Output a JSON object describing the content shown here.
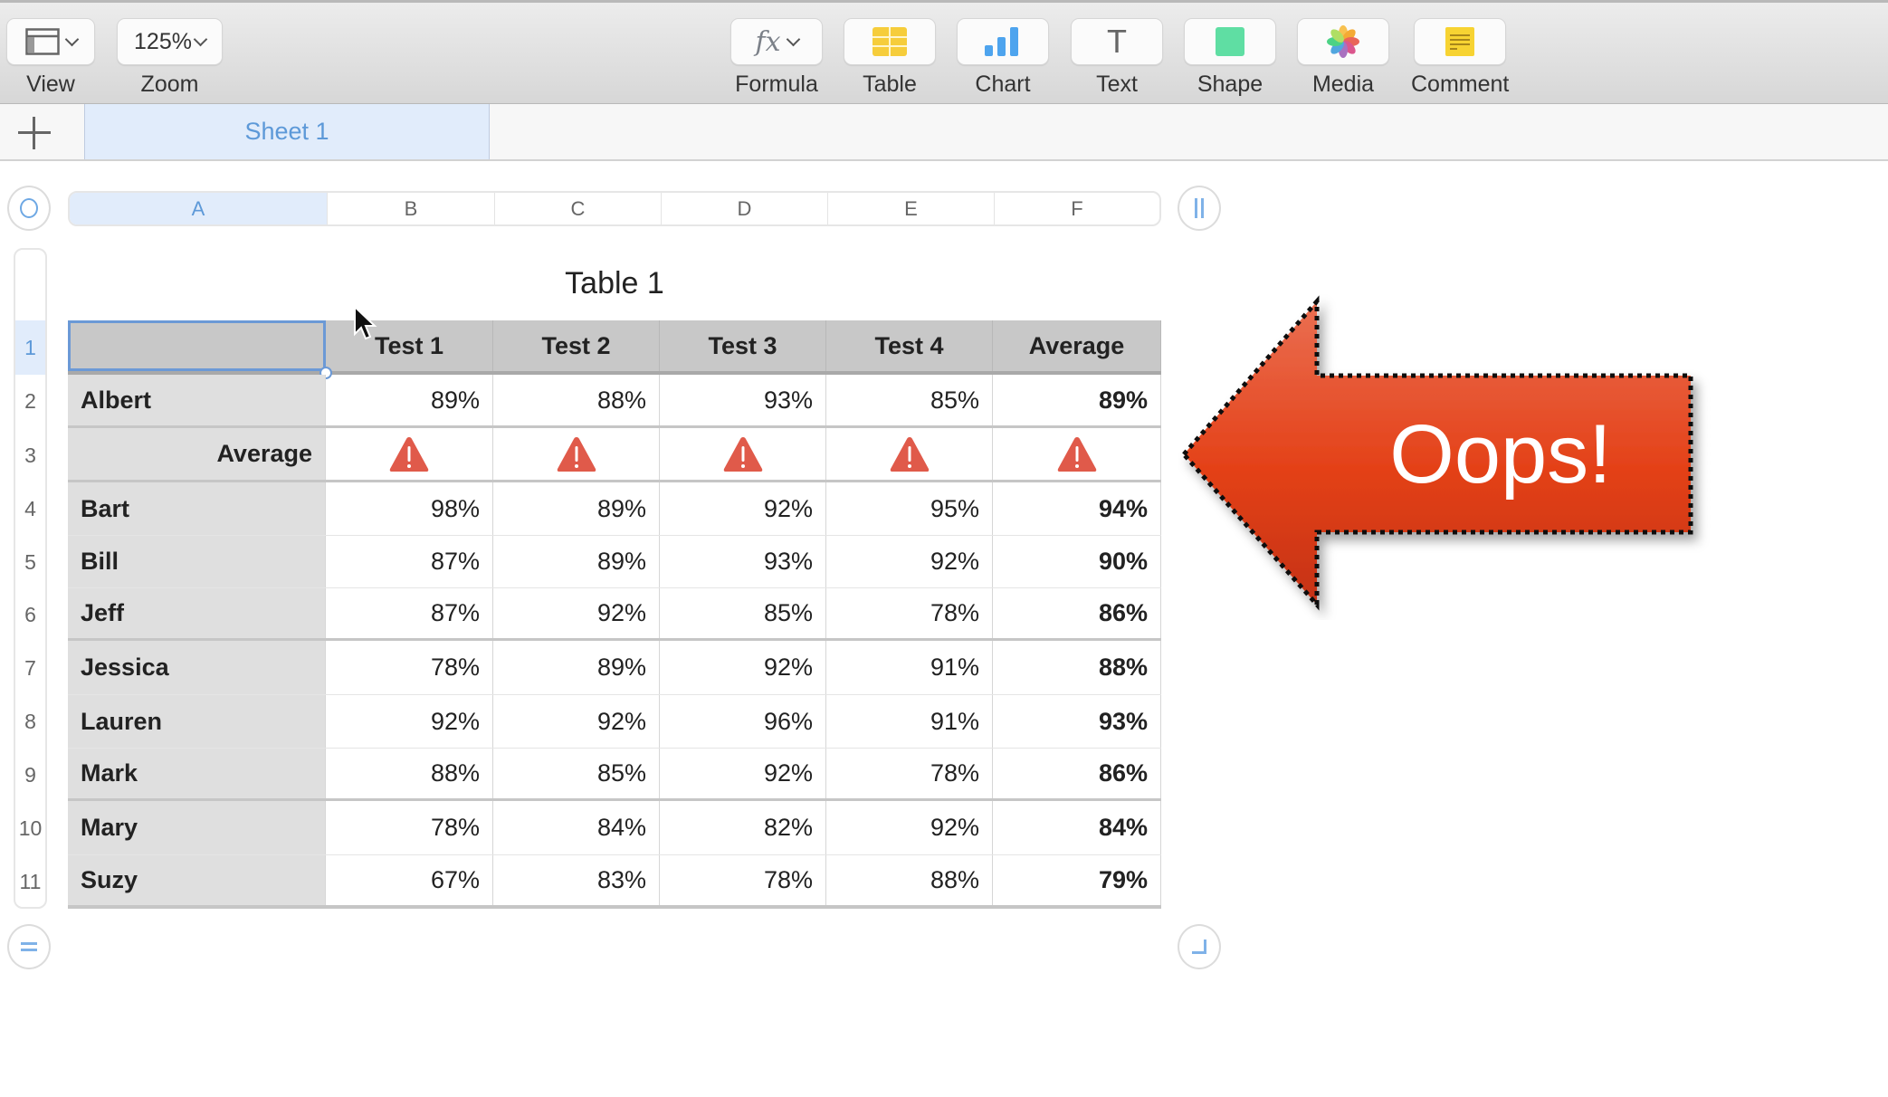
{
  "toolbar": {
    "left": [
      {
        "id": "view",
        "icon": "sidebar-layout-icon",
        "label": "View"
      },
      {
        "id": "zoom",
        "value": "125%",
        "label": "Zoom"
      }
    ],
    "right": [
      {
        "id": "formula",
        "icon": "fx-icon",
        "icon_text": "fx",
        "label": "Formula"
      },
      {
        "id": "table",
        "icon": "table-icon",
        "label": "Table"
      },
      {
        "id": "chart",
        "icon": "bar-chart-icon",
        "label": "Chart"
      },
      {
        "id": "text",
        "icon": "text-icon",
        "icon_text": "T",
        "label": "Text"
      },
      {
        "id": "shape",
        "icon": "shape-icon",
        "label": "Shape"
      },
      {
        "id": "media",
        "icon": "photos-icon",
        "label": "Media"
      },
      {
        "id": "comment",
        "icon": "comment-icon",
        "label": "Comment"
      }
    ]
  },
  "tabs": {
    "add_icon": "plus-icon",
    "sheets": [
      {
        "label": "Sheet 1",
        "active": true
      }
    ]
  },
  "spreadsheet": {
    "columns": [
      "A",
      "B",
      "C",
      "D",
      "E",
      "F"
    ],
    "selected_column": "A",
    "selected_row": "1",
    "row_numbers": [
      "1",
      "2",
      "3",
      "4",
      "5",
      "6",
      "7",
      "8",
      "9",
      "10",
      "11"
    ],
    "table_title": "Table 1",
    "header": [
      "",
      "Test 1",
      "Test 2",
      "Test 3",
      "Test 4",
      "Average"
    ],
    "rows": [
      {
        "name": "Albert",
        "values": [
          "89%",
          "88%",
          "93%",
          "85%"
        ],
        "average": "89%"
      },
      {
        "name": "Average",
        "type": "error",
        "values": [
          "warning",
          "warning",
          "warning",
          "warning"
        ],
        "average": "warning"
      },
      {
        "name": "Bart",
        "values": [
          "98%",
          "89%",
          "92%",
          "95%"
        ],
        "average": "94%"
      },
      {
        "name": "Bill",
        "values": [
          "87%",
          "89%",
          "93%",
          "92%"
        ],
        "average": "90%"
      },
      {
        "name": "Jeff",
        "values": [
          "87%",
          "92%",
          "85%",
          "78%"
        ],
        "average": "86%"
      },
      {
        "name": "Jessica",
        "values": [
          "78%",
          "89%",
          "92%",
          "91%"
        ],
        "average": "88%"
      },
      {
        "name": "Lauren",
        "values": [
          "92%",
          "92%",
          "96%",
          "91%"
        ],
        "average": "93%"
      },
      {
        "name": "Mark",
        "values": [
          "88%",
          "85%",
          "92%",
          "78%"
        ],
        "average": "86%"
      },
      {
        "name": "Mary",
        "values": [
          "78%",
          "84%",
          "82%",
          "92%"
        ],
        "average": "84%"
      },
      {
        "name": "Suzy",
        "values": [
          "67%",
          "83%",
          "78%",
          "88%"
        ],
        "average": "79%"
      }
    ],
    "controls": {
      "select_all_icon": "circle-select-icon",
      "column_handle_icon": "pause-bars-icon",
      "row_handle_icon": "equals-icon",
      "resize_icon": "corner-resize-icon"
    }
  },
  "annotation": {
    "text": "Oops!",
    "shape": "left-arrow",
    "fill_top": "#e8674a",
    "fill_bottom": "#cc3718"
  },
  "colors": {
    "accent": "#5d99d8",
    "selection": "#e1ecfb",
    "warning": "#e05a4a"
  }
}
